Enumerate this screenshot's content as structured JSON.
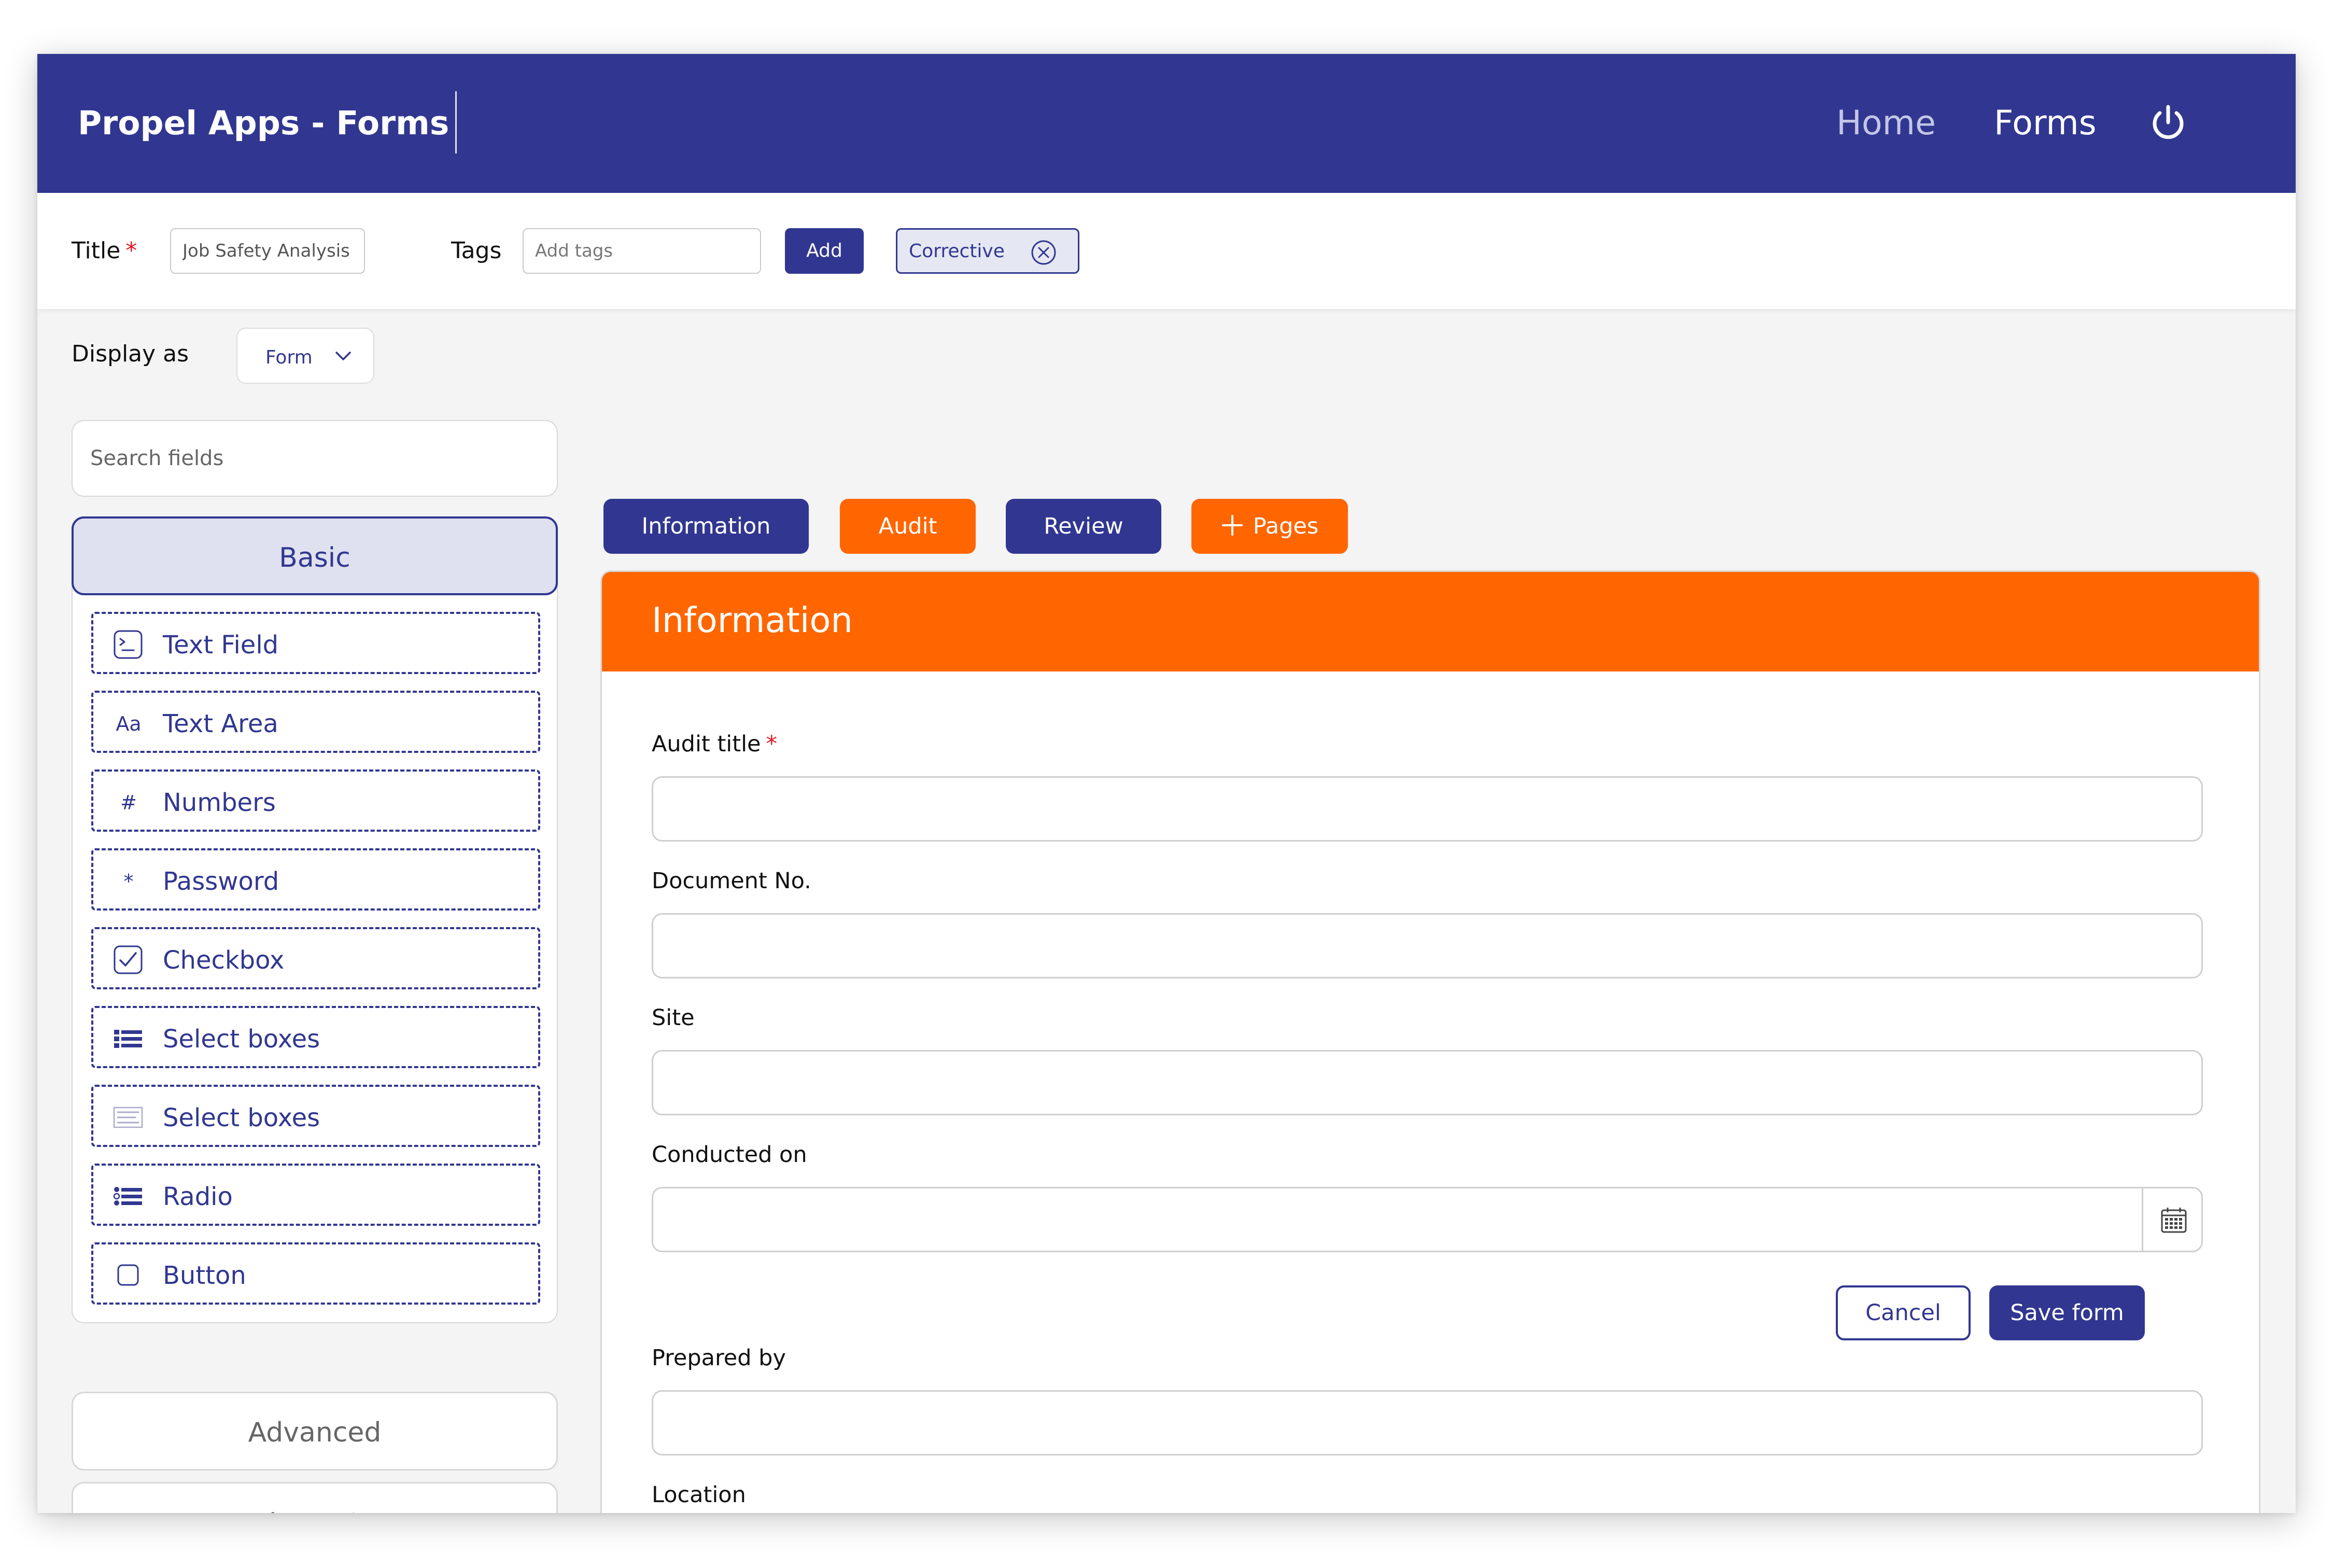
{
  "header": {
    "app_title": "Propel Apps - Forms",
    "nav_home": "Home",
    "nav_forms": "Forms",
    "power_icon": "power-icon"
  },
  "titlebar": {
    "title_label": "Title",
    "required_mark": "*",
    "title_value": "Job Safety Analysis Form",
    "tags_label": "Tags",
    "tags_placeholder": "Add tags",
    "add_label": "Add",
    "tag_chip": "Corrective",
    "tag_remove_icon": "close-circle-icon"
  },
  "display": {
    "label": "Display as",
    "value": "Form"
  },
  "sidebar": {
    "search_placeholder": "Search fields",
    "basic_label": "Basic",
    "fields": [
      {
        "label": "Text Field",
        "icon": "terminal-icon"
      },
      {
        "label": "Text Area",
        "icon": "Aa"
      },
      {
        "label": "Numbers",
        "icon": "#"
      },
      {
        "label": "Password",
        "icon": "*"
      },
      {
        "label": "Checkbox",
        "icon": "checkbox-checked-icon"
      },
      {
        "label": "Select boxes",
        "icon": "list-bullets-icon"
      },
      {
        "label": "Select boxes",
        "icon": "list-lines-icon"
      },
      {
        "label": "Radio",
        "icon": "radio-list-icon"
      },
      {
        "label": "Button",
        "icon": "square-icon"
      }
    ],
    "advanced_label": "Advanced",
    "layout_label": "Layout"
  },
  "tabs": [
    {
      "label": "Information"
    },
    {
      "label": "Audit"
    },
    {
      "label": "Review"
    },
    {
      "label": "Pages"
    }
  ],
  "form": {
    "title": "Information",
    "fields": [
      {
        "label": "Audit title",
        "required": "*"
      },
      {
        "label": "Document No."
      },
      {
        "label": "Site"
      },
      {
        "label": "Conducted on"
      },
      {
        "label": "Prepared by"
      },
      {
        "label": "Location"
      }
    ],
    "cancel_label": "Cancel",
    "save_label": "Save form"
  },
  "colors": {
    "brand_blue": "#313790",
    "accent_orange": "#ff6600",
    "required_red": "#e31b23"
  }
}
